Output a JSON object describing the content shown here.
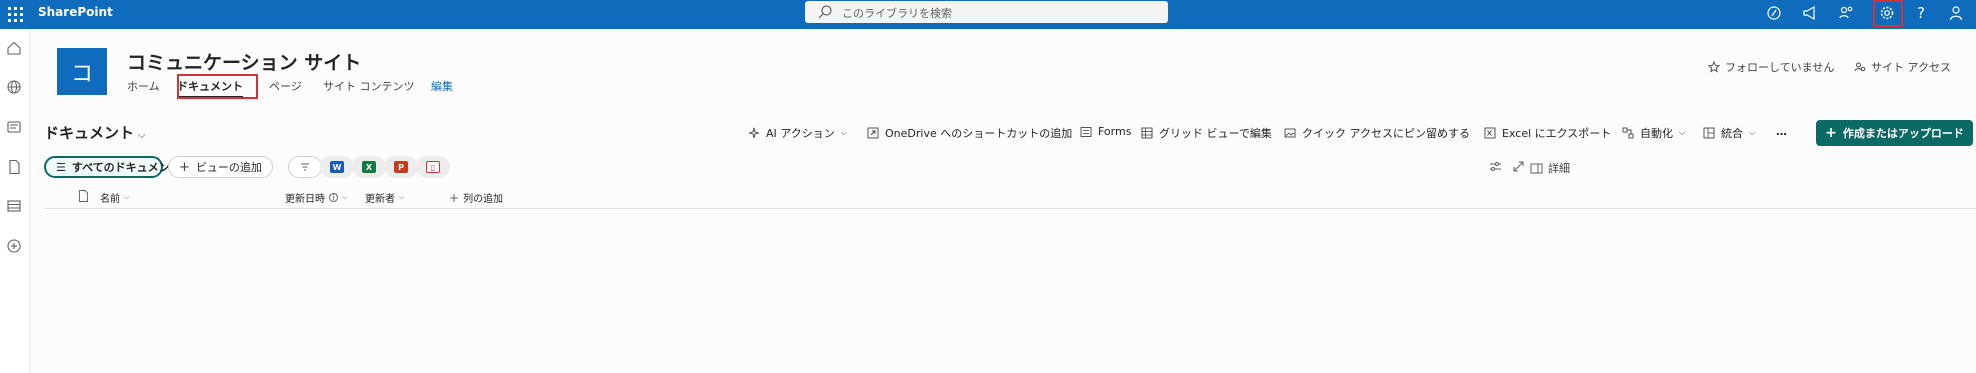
{
  "topbar": {
    "brand": "SharePoint",
    "search_placeholder": "このライブラリを検索",
    "icons": [
      "copilot-icon",
      "megaphone-icon",
      "share-people-icon",
      "settings-icon",
      "help-icon",
      "account-icon"
    ]
  },
  "leftrail": {
    "icons": [
      "home-icon",
      "globe-icon",
      "news-icon",
      "file-icon",
      "list-icon",
      "create-icon"
    ]
  },
  "site": {
    "logo_letter": "コ",
    "title": "コミュニケーション サイト",
    "nav": [
      {
        "label": "ホーム"
      },
      {
        "label": "ドキュメント"
      },
      {
        "label": "ページ"
      },
      {
        "label": "サイト コンテンツ"
      },
      {
        "label": "編集"
      }
    ],
    "follow_label": "フォローしていません",
    "access_label": "サイト アクセス"
  },
  "library": {
    "title": "ドキュメント",
    "commands": {
      "ai": "AI アクション",
      "onedrive": "OneDrive へのショートカットの追加",
      "forms": "Forms",
      "grid": "グリッド ビューで編集",
      "pin": "クイック アクセスにピン留めする",
      "excel": "Excel にエクスポート",
      "automate": "自動化",
      "integrate": "統合",
      "more": "…",
      "create": "作成またはアップロード"
    },
    "views": {
      "all_docs": "すべてのドキュメント",
      "add_view": "ビューの追加"
    },
    "details_label": "詳細",
    "columns": {
      "name": "名前",
      "modified": "更新日時",
      "modified_by": "更新者",
      "add_column": "列の追加"
    }
  },
  "colors": {
    "suite_bar": "#0f6cbd",
    "accent": "#0b6a64",
    "highlight": "#d13438"
  }
}
